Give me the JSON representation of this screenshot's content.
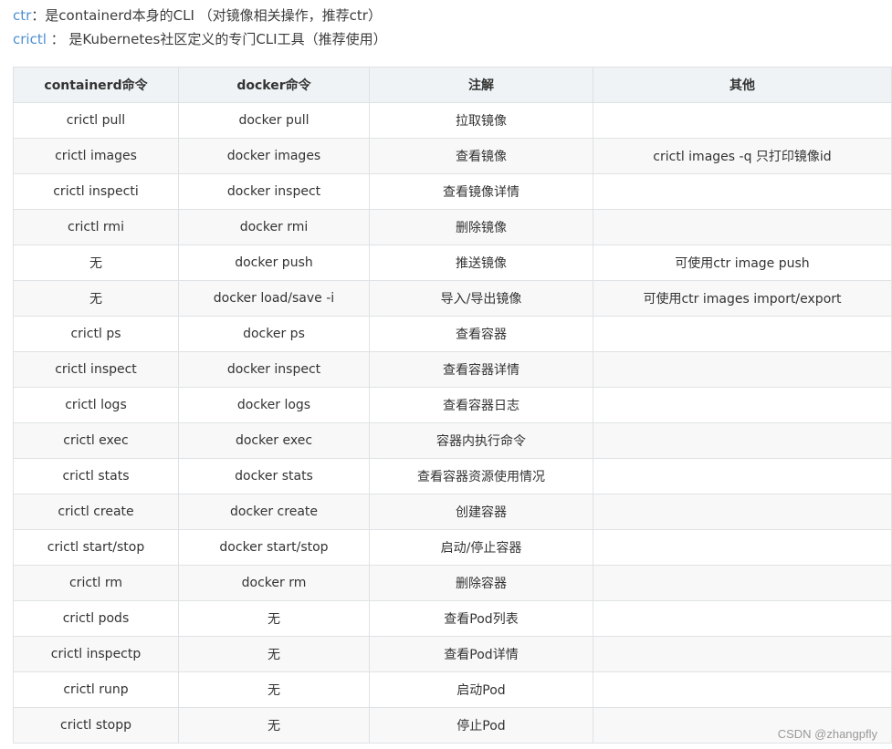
{
  "intro": {
    "line1": {
      "term": "ctr",
      "text": "：是containerd本身的CLI （对镜像相关操作，推荐ctr）"
    },
    "line2": {
      "term": "crictl",
      "text": " ：  是Kubernetes社区定义的专门CLI工具（推荐使用）"
    }
  },
  "table": {
    "headers": [
      "containerd命令",
      "docker命令",
      "注解",
      "其他"
    ],
    "rows": [
      [
        "crictl pull",
        "docker pull",
        "拉取镜像",
        ""
      ],
      [
        "crictl images",
        "docker images",
        "查看镜像",
        "crictl images -q 只打印镜像id"
      ],
      [
        "crictl inspecti",
        "docker inspect",
        "查看镜像详情",
        ""
      ],
      [
        "crictl rmi",
        "docker rmi",
        "删除镜像",
        ""
      ],
      [
        "无",
        "docker push",
        "推送镜像",
        "可使用ctr image push"
      ],
      [
        "无",
        "docker load/save -i",
        "导入/导出镜像",
        "可使用ctr images import/export"
      ],
      [
        "crictl ps",
        "docker ps",
        "查看容器",
        ""
      ],
      [
        "crictl inspect",
        "docker inspect",
        "查看容器详情",
        ""
      ],
      [
        "crictl logs",
        "docker logs",
        "查看容器日志",
        ""
      ],
      [
        "crictl exec",
        "docker exec",
        "容器内执行命令",
        ""
      ],
      [
        "crictl stats",
        "docker stats",
        "查看容器资源使用情况",
        ""
      ],
      [
        "crictl create",
        "docker create",
        "创建容器",
        ""
      ],
      [
        "crictl start/stop",
        "docker start/stop",
        "启动/停止容器",
        ""
      ],
      [
        "crictl rm",
        "docker rm",
        "删除容器",
        ""
      ],
      [
        "crictl pods",
        "无",
        "查看Pod列表",
        ""
      ],
      [
        "crictl inspectp",
        "无",
        "查看Pod详情",
        ""
      ],
      [
        "crictl runp",
        "无",
        "启动Pod",
        ""
      ],
      [
        "crictl stopp",
        "无",
        "停止Pod",
        ""
      ]
    ]
  },
  "watermark": "CSDN @zhangpfly"
}
